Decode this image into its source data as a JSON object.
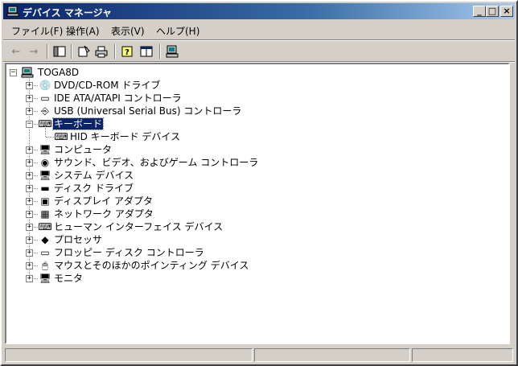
{
  "window": {
    "title": "デバイス マネージャ",
    "min_label": "_",
    "max_label": "□",
    "close_label": "×"
  },
  "menu": [
    "ファイル(F)",
    "操作(A)",
    "表示(V)",
    "ヘルプ(H)"
  ],
  "toolbar": {
    "back": "←",
    "forward": "→"
  },
  "tree": {
    "root": "TOGA8D",
    "items": [
      {
        "label": "DVD/CD-ROM ドライブ",
        "icon": "cdrom-icon",
        "glyph": "💿",
        "expander": "+"
      },
      {
        "label": "IDE ATA/ATAPI コントローラ",
        "icon": "ide-controller-icon",
        "glyph": "▭",
        "expander": "+"
      },
      {
        "label": "USB (Universal Serial Bus) コントローラ",
        "icon": "usb-icon",
        "glyph": "⎆",
        "expander": "+"
      },
      {
        "label": "キーボード",
        "icon": "keyboard-icon",
        "glyph": "⌨",
        "expander": "−",
        "selected": true,
        "children": [
          {
            "label": "HID キーボード デバイス",
            "icon": "keyboard-icon",
            "glyph": "⌨"
          }
        ]
      },
      {
        "label": "コンピュータ",
        "icon": "computer-icon",
        "glyph": "🖥",
        "expander": "+"
      },
      {
        "label": "サウンド、ビデオ、およびゲーム コントローラ",
        "icon": "sound-icon",
        "glyph": "◉",
        "expander": "+"
      },
      {
        "label": "システム デバイス",
        "icon": "system-device-icon",
        "glyph": "🖥",
        "expander": "+"
      },
      {
        "label": "ディスク ドライブ",
        "icon": "disk-drive-icon",
        "glyph": "▬",
        "expander": "+"
      },
      {
        "label": "ディスプレイ アダプタ",
        "icon": "display-adapter-icon",
        "glyph": "▣",
        "expander": "+"
      },
      {
        "label": "ネットワーク アダプタ",
        "icon": "network-adapter-icon",
        "glyph": "▦",
        "expander": "+"
      },
      {
        "label": "ヒューマン インターフェイス デバイス",
        "icon": "hid-icon",
        "glyph": "⌨",
        "expander": "+"
      },
      {
        "label": "プロセッサ",
        "icon": "processor-icon",
        "glyph": "◆",
        "expander": "+"
      },
      {
        "label": "フロッピー ディスク コントローラ",
        "icon": "floppy-controller-icon",
        "glyph": "▭",
        "expander": "+"
      },
      {
        "label": "マウスとそのほかのポインティング デバイス",
        "icon": "mouse-icon",
        "glyph": "🖱",
        "expander": "+"
      },
      {
        "label": "モニタ",
        "icon": "monitor-icon",
        "glyph": "🖥",
        "expander": "+"
      }
    ]
  },
  "colors": {
    "selection": "#0a246a",
    "titlebar_start": "#0a246a",
    "face": "#d4d0c8"
  }
}
